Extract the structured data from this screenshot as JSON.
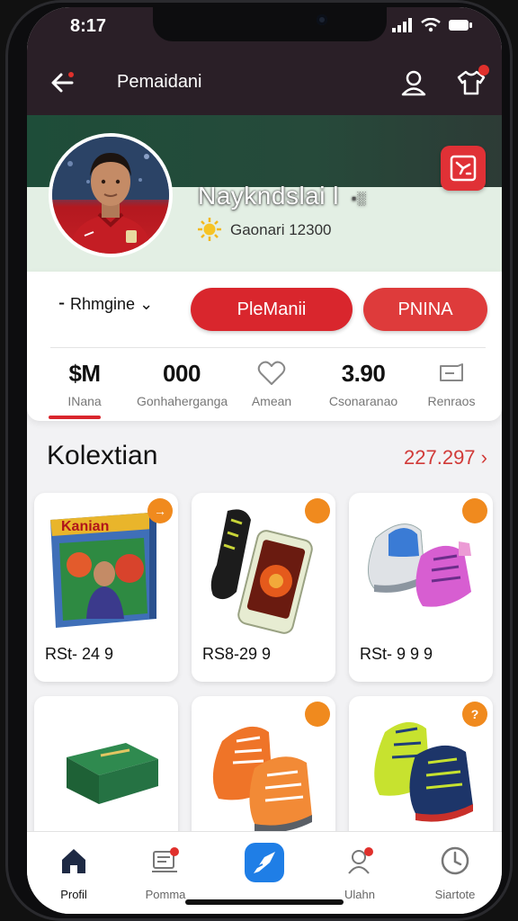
{
  "status_bar": {
    "time": "8:17"
  },
  "header": {
    "title": "Pemaidani"
  },
  "profile": {
    "name": "Naykndslai l",
    "name_badge": "▪░",
    "score_text": "Gaonari 12300",
    "dropdown_label": "Rhmgine",
    "primary_button": "PleManii",
    "secondary_button": "PNINA"
  },
  "stats": [
    {
      "value": "$M",
      "label": "INana"
    },
    {
      "value": "000",
      "label": "Gonhaherganga"
    },
    {
      "icon": "heart-icon",
      "label": "Amean"
    },
    {
      "value": "3.90",
      "label": "Csonaranao"
    },
    {
      "icon": "tag-icon",
      "label": "Renraos"
    }
  ],
  "section": {
    "title": "Kolextian",
    "link": "227.297"
  },
  "items": [
    {
      "price": "RSt- 24 9",
      "badge": "→",
      "thumb": "boxed-game"
    },
    {
      "price": "RS8-29 9",
      "badge": "",
      "thumb": "boots-phone"
    },
    {
      "price": "RSt- 9 9 9",
      "badge": "",
      "thumb": "sneakers-blue-pink"
    },
    {
      "price": "",
      "badge": "",
      "thumb": "green-box"
    },
    {
      "price": "",
      "badge": "",
      "thumb": "orange-boots"
    },
    {
      "price": "",
      "badge": "?",
      "thumb": "green-navy-boots"
    }
  ],
  "bottom_nav": [
    {
      "label": "Profil",
      "icon": "home-icon",
      "active": true
    },
    {
      "label": "Pomma",
      "icon": "cart-icon",
      "active": false
    },
    {
      "label": "",
      "icon": "share-icon",
      "active": false
    },
    {
      "label": "Ulahn",
      "icon": "chat-icon",
      "active": false
    },
    {
      "label": "Siartote",
      "icon": "clock-icon",
      "active": false
    }
  ],
  "colors": {
    "accent": "#d9262d",
    "header_bg": "#2a1f27",
    "banner": "#e3efe4",
    "badge": "#f08a1e"
  }
}
